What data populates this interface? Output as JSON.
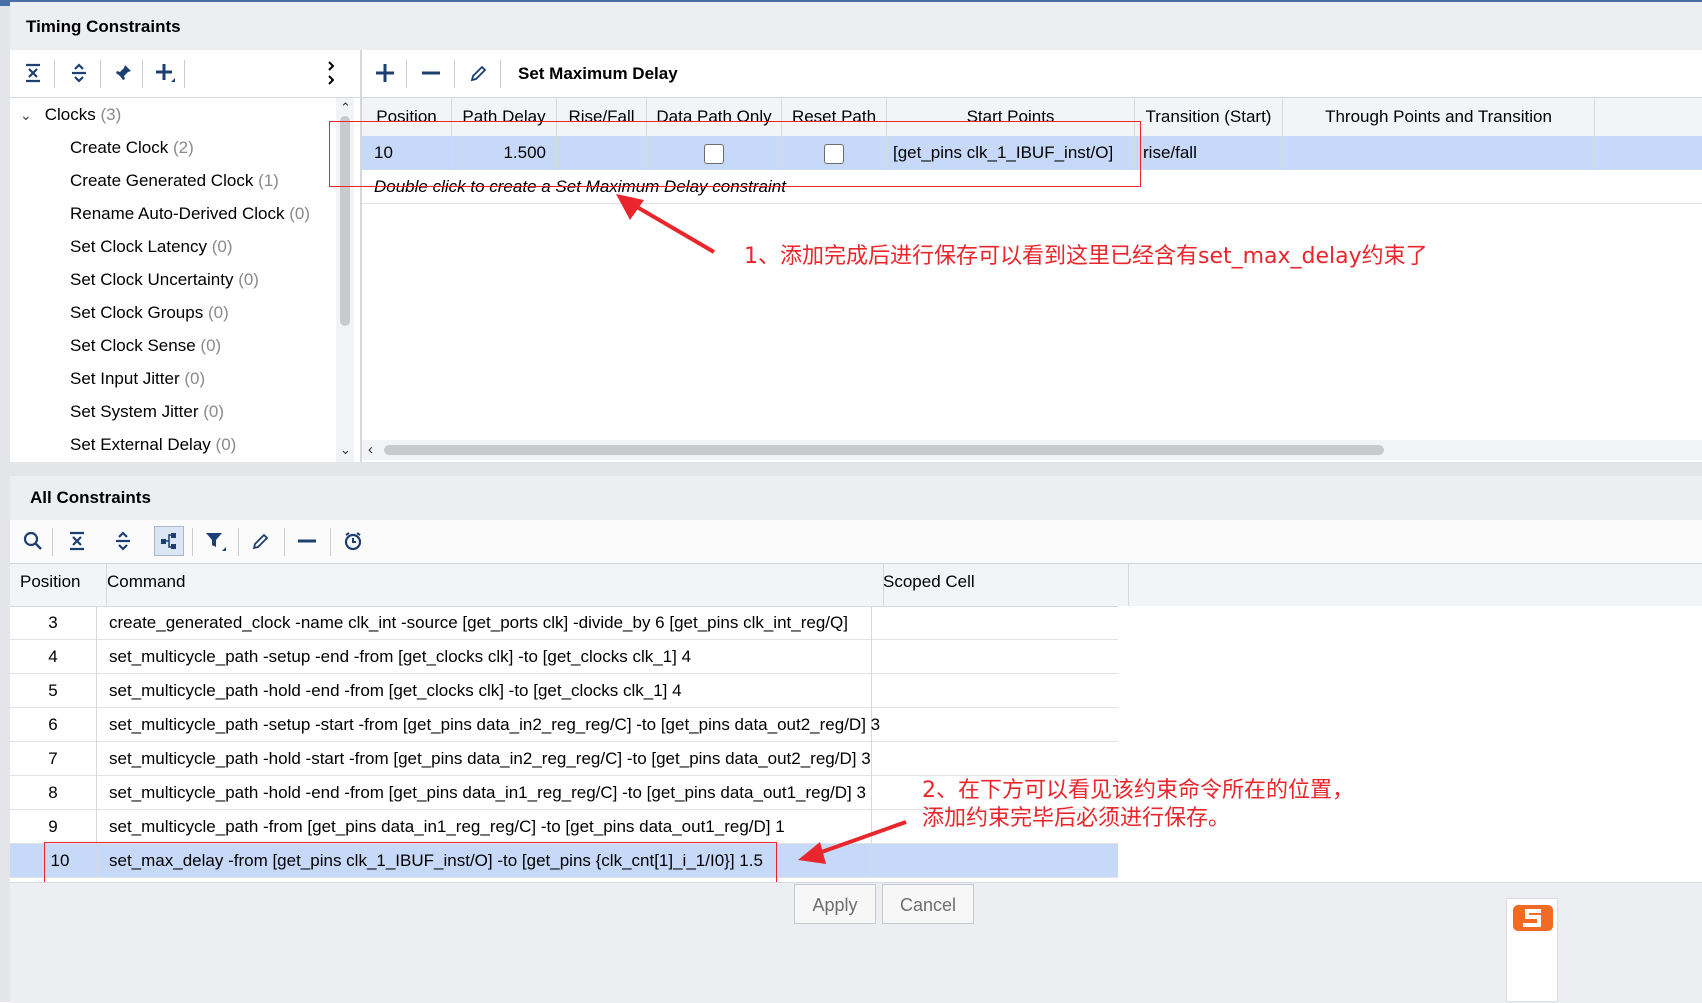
{
  "timing_panel": {
    "title": "Timing Constraints",
    "tree": {
      "items": [
        {
          "label": "Clocks",
          "count": "(3)"
        },
        {
          "label": "Create Clock",
          "count": "(2)"
        },
        {
          "label": "Create Generated Clock",
          "count": "(1)"
        },
        {
          "label": "Rename Auto-Derived Clock",
          "count": "(0)"
        },
        {
          "label": "Set Clock Latency",
          "count": "(0)"
        },
        {
          "label": "Set Clock Uncertainty",
          "count": "(0)"
        },
        {
          "label": "Set Clock Groups",
          "count": "(0)"
        },
        {
          "label": "Set Clock Sense",
          "count": "(0)"
        },
        {
          "label": "Set Input Jitter",
          "count": "(0)"
        },
        {
          "label": "Set System Jitter",
          "count": "(0)"
        },
        {
          "label": "Set External Delay",
          "count": "(0)"
        }
      ]
    },
    "editor": {
      "title": "Set Maximum Delay",
      "columns": [
        "Position",
        "Path Delay",
        "Rise/Fall",
        "Data Path Only",
        "Reset Path",
        "Start Points",
        "Transition (Start)",
        "Through Points and Transition"
      ],
      "row": {
        "position": "10",
        "path_delay": "1.500",
        "rise_fall": "",
        "start_points": "[get_pins clk_1_IBUF_inst/O]",
        "transition": "rise/fall"
      },
      "hint": "Double click to create a Set Maximum Delay constraint"
    }
  },
  "all_constraints": {
    "title": "All Constraints",
    "columns": [
      "Position",
      "Command",
      "Scoped Cell"
    ],
    "rows": [
      {
        "position": "3",
        "command": "create_generated_clock -name clk_int -source [get_ports clk] -divide_by 6 [get_pins clk_int_reg/Q]"
      },
      {
        "position": "4",
        "command": "set_multicycle_path -setup -end -from [get_clocks clk] -to [get_clocks clk_1] 4"
      },
      {
        "position": "5",
        "command": "set_multicycle_path -hold -end -from [get_clocks clk] -to [get_clocks clk_1] 4"
      },
      {
        "position": "6",
        "command": "set_multicycle_path -setup -start -from [get_pins data_in2_reg_reg/C] -to [get_pins data_out2_reg/D] 3"
      },
      {
        "position": "7",
        "command": "set_multicycle_path -hold -start -from [get_pins data_in2_reg_reg/C] -to [get_pins data_out2_reg/D] 3"
      },
      {
        "position": "8",
        "command": "set_multicycle_path -hold -end -from [get_pins data_in1_reg_reg/C] -to [get_pins data_out1_reg/D] 3"
      },
      {
        "position": "9",
        "command": "set_multicycle_path -from [get_pins data_in1_reg_reg/C] -to [get_pins data_out1_reg/D] 1"
      },
      {
        "position": "10",
        "command": "set_max_delay -from [get_pins clk_1_IBUF_inst/O] -to [get_pins {clk_cnt[1]_i_1/I0}] 1.5"
      }
    ]
  },
  "buttons": {
    "apply": "Apply",
    "cancel": "Cancel"
  },
  "annotations": {
    "note1": "1、添加完成后进行保存可以看到这里已经含有set_max_delay约束了",
    "note2_line1": "2、在下方可以看见该约束命令所在的位置，",
    "note2_line2": "添加约束完毕后必须进行保存。"
  },
  "colors": {
    "accent": "#1e3f72",
    "selection": "#c7d9f8",
    "annotation": "#e8262b"
  }
}
